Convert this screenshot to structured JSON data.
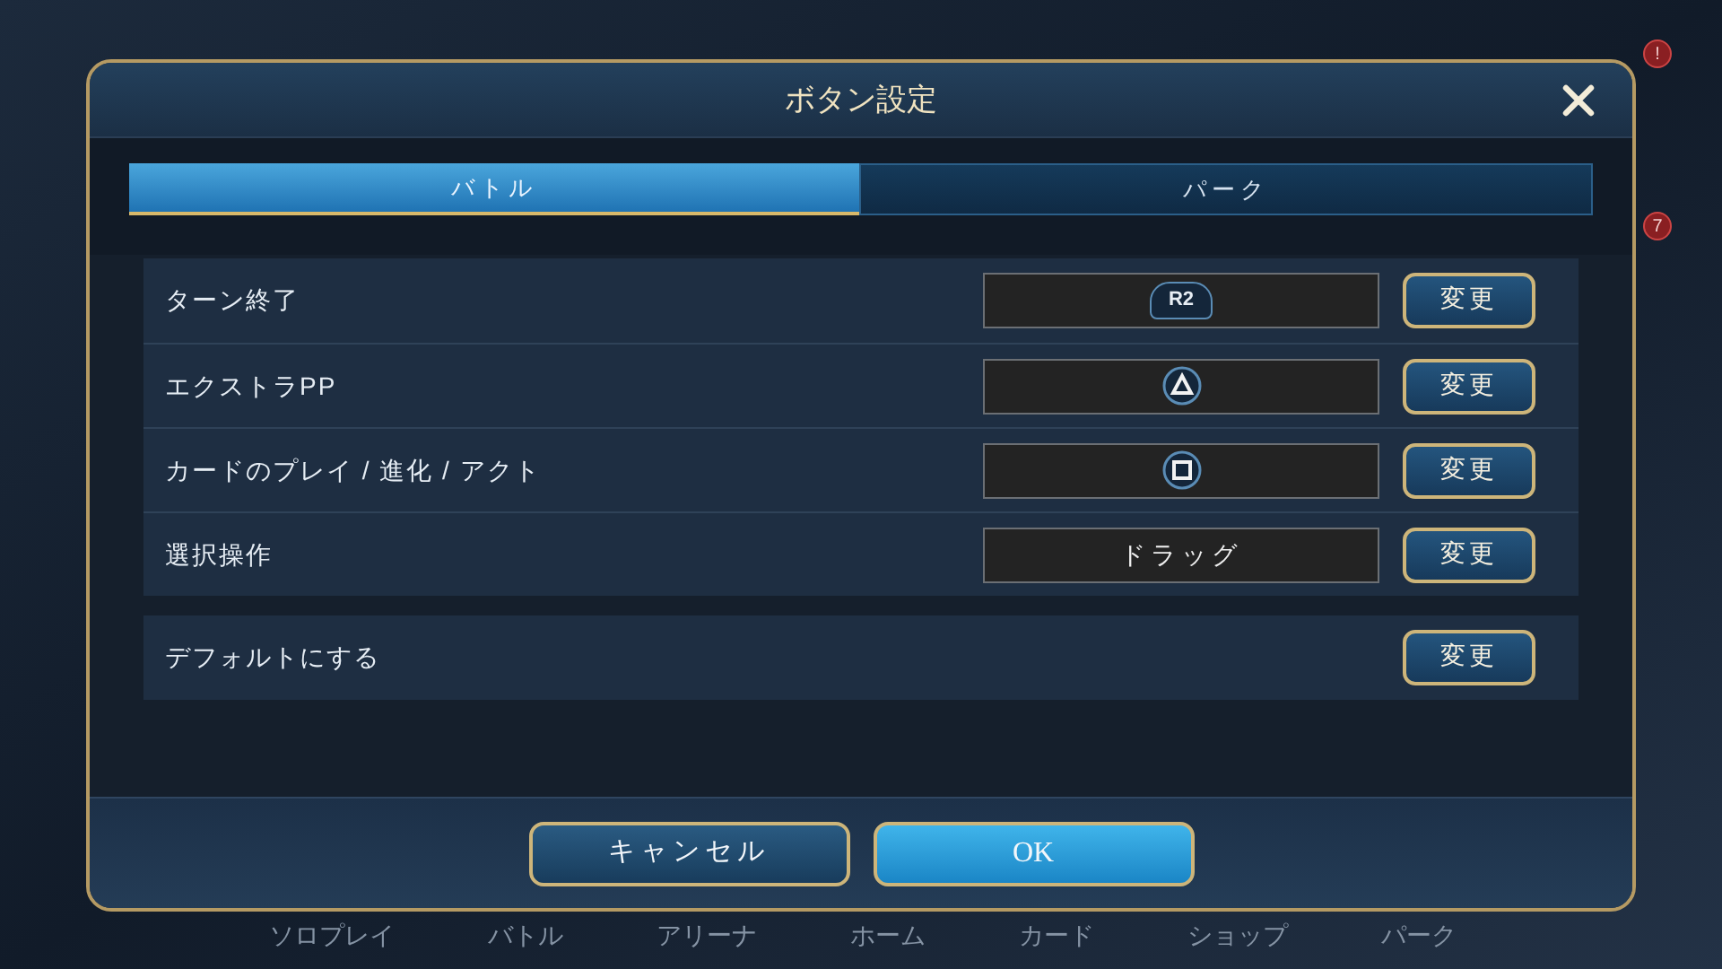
{
  "background": {
    "bottom_nav": [
      "ソロプレイ",
      "バトル",
      "アリーナ",
      "ホーム",
      "カード",
      "ショップ",
      "パーク"
    ],
    "badges": [
      "!",
      "7"
    ]
  },
  "dialog": {
    "title": "ボタン設定",
    "tabs": [
      {
        "label": "バトル",
        "selected": true
      },
      {
        "label": "パーク",
        "selected": false
      }
    ],
    "bindings": [
      {
        "label": "ターン終了",
        "kind": "pill",
        "value": "R2",
        "button": "変更"
      },
      {
        "label": "エクストラPP",
        "kind": "triangle",
        "button": "変更"
      },
      {
        "label": "カードのプレイ / 進化 / アクト",
        "kind": "square",
        "button": "変更"
      },
      {
        "label": "選択操作",
        "kind": "text",
        "value": "ドラッグ",
        "button": "変更"
      }
    ],
    "reset": {
      "label": "デフォルトにする",
      "button": "変更"
    },
    "footer_buttons": [
      {
        "label": "キャンセル",
        "kind": "secondary"
      },
      {
        "label": "OK",
        "kind": "primary"
      }
    ]
  }
}
